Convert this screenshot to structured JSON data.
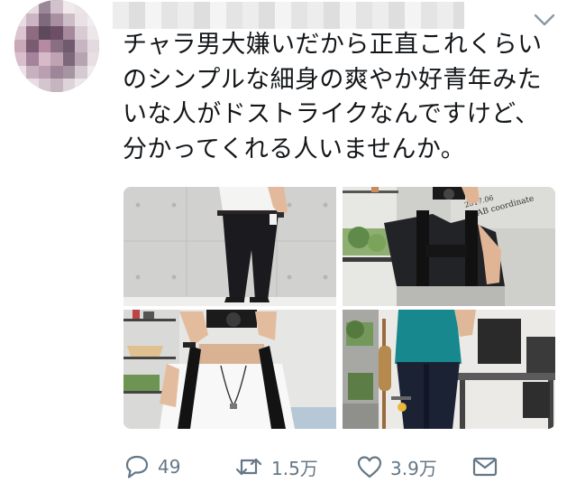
{
  "tweet": {
    "text": "チャラ男大嫌いだから正直これくらい\nのシンプルな細身の爽やか好青年みた\nいな人がドストライクなんですけど、\n分かってくれる人いませんか。",
    "colors": {
      "text": "#14171a",
      "muted": "#657786",
      "chevron": "#8899a6"
    },
    "header": {
      "menu_icon": "chevron-down-icon"
    },
    "media": {
      "photos": [
        {
          "id": "photo-1",
          "description": "white tee, black slim trousers, concrete wall"
        },
        {
          "id": "photo-2",
          "description": "black shirt, mirror selfie with camera",
          "overlay_text": "2017.06\nAB coordinate"
        },
        {
          "id": "photo-3",
          "description": "white tee, backpack, camera selfie"
        },
        {
          "id": "photo-4",
          "description": "teal top, navy trousers, desk room"
        }
      ]
    },
    "actions": {
      "reply": {
        "icon": "reply-icon",
        "count": "49"
      },
      "retweet": {
        "icon": "retweet-icon",
        "count": "1.5万"
      },
      "like": {
        "icon": "heart-icon",
        "count": "3.9万"
      },
      "dm": {
        "icon": "envelope-icon"
      }
    }
  }
}
